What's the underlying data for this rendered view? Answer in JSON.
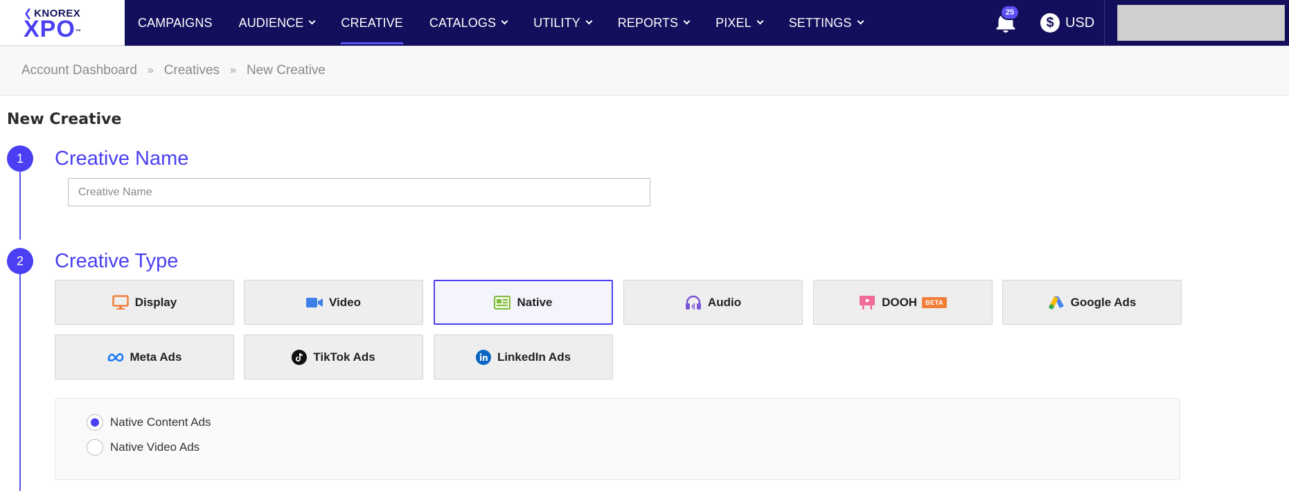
{
  "brand": {
    "small": "KNOREX",
    "big": "XPO",
    "tm": "™",
    "accent": "#4a3ff2",
    "navy": "#130f5c"
  },
  "nav": {
    "items": [
      {
        "label": "CAMPAIGNS",
        "dropdown": false,
        "active": false
      },
      {
        "label": "AUDIENCE",
        "dropdown": true,
        "active": false
      },
      {
        "label": "CREATIVE",
        "dropdown": false,
        "active": true
      },
      {
        "label": "CATALOGS",
        "dropdown": true,
        "active": false
      },
      {
        "label": "UTILITY",
        "dropdown": true,
        "active": false
      },
      {
        "label": "REPORTS",
        "dropdown": true,
        "active": false
      },
      {
        "label": "PIXEL",
        "dropdown": true,
        "active": false
      },
      {
        "label": "SETTINGS",
        "dropdown": true,
        "active": false
      }
    ],
    "notifications_count": "25",
    "currency_symbol": "$",
    "currency": "USD"
  },
  "breadcrumb": [
    "Account Dashboard",
    "Creatives",
    "New Creative"
  ],
  "breadcrumb_separator": "»",
  "page": {
    "title": "New Creative"
  },
  "steps": {
    "name": {
      "number": "1",
      "title": "Creative Name",
      "placeholder": "Creative Name",
      "value": ""
    },
    "type": {
      "number": "2",
      "title": "Creative Type",
      "options": [
        {
          "label": "Display",
          "icon": "monitor-icon",
          "selected": false
        },
        {
          "label": "Video",
          "icon": "video-camera-icon",
          "selected": false
        },
        {
          "label": "Native",
          "icon": "native-layout-icon",
          "selected": true
        },
        {
          "label": "Audio",
          "icon": "headphones-icon",
          "selected": false
        },
        {
          "label": "DOOH",
          "icon": "billboard-icon",
          "selected": false,
          "badge": "BETA"
        },
        {
          "label": "Google Ads",
          "icon": "google-ads-icon",
          "selected": false
        },
        {
          "label": "Meta Ads",
          "icon": "meta-icon",
          "selected": false
        },
        {
          "label": "TikTok Ads",
          "icon": "tiktok-icon",
          "selected": false
        },
        {
          "label": "LinkedIn Ads",
          "icon": "linkedin-icon",
          "selected": false
        }
      ],
      "subtypes": [
        {
          "label": "Native Content Ads",
          "checked": true
        },
        {
          "label": "Native Video Ads",
          "checked": false
        }
      ]
    }
  }
}
